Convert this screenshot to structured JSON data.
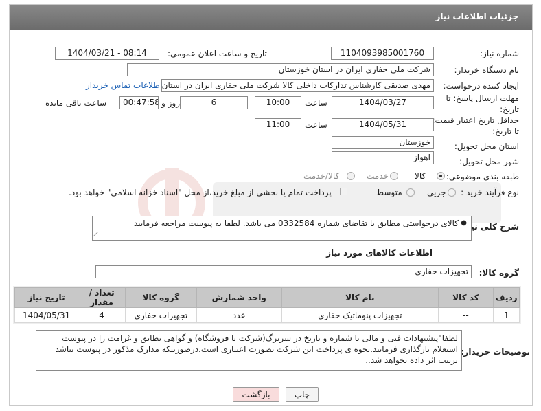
{
  "header": {
    "title": "جزئیات اطلاعات نیاز"
  },
  "need_number": {
    "label": "شماره نیاز:",
    "value": "1104093985001760"
  },
  "announce_datetime": {
    "label": "تاریخ و ساعت اعلان عمومی:",
    "value": "1404/03/21 - 08:14"
  },
  "buyer_org": {
    "label": "نام دستگاه خریدار:",
    "value": "شرکت ملی حفاری ایران در استان خوزستان"
  },
  "requester": {
    "label": "ایجاد کننده درخواست:",
    "value": "مهدی صدیقی کارشناس تدارکات داخلی کالا شرکت ملی حفاری ایران در استان",
    "contact_link": "اطلاعات تماس خریدار"
  },
  "reply_deadline": {
    "label_line1": "مهلت ارسال پاسخ: تا",
    "label_line2": "تاریخ:",
    "date": "1404/03/27",
    "time_label": "ساعت",
    "time": "10:00",
    "days": "6",
    "days_label": "روز و",
    "remaining": "00:47:58",
    "remaining_label": "ساعت باقی مانده"
  },
  "price_validity": {
    "label_line1": "حداقل تاریخ اعتبار قیمت:",
    "label_line2": "تا تاریخ:",
    "date": "1404/05/31",
    "time_label": "ساعت",
    "time": "11:00"
  },
  "delivery_province": {
    "label": "استان محل تحویل:",
    "value": "خوزستان"
  },
  "delivery_city": {
    "label": "شهر محل تحویل:",
    "value": "اهواز"
  },
  "category": {
    "label": "طبقه بندی موضوعی:",
    "options": [
      "کالا",
      "خدمت",
      "کالا/خدمت"
    ],
    "selected": "کالا"
  },
  "purchase_type": {
    "label": "نوع فرآیند خرید :",
    "options": [
      "جزیی",
      "متوسط"
    ],
    "payment_note": "پرداخت تمام یا بخشی از مبلغ خرید،از محل \"اسناد خزانه اسلامی\" خواهد بود."
  },
  "general_description": {
    "label": "شرح کلی نیاز:",
    "text": "کالای درخواستی مطابق با تقاضای شماره 0332584 می باشد. لطفا به پیوست مراجعه فرمایید"
  },
  "goods_section": {
    "title": "اطلاعات کالاهای مورد نیاز",
    "group_label": "گروه کالا:",
    "group_value": "تجهیزات حفاری"
  },
  "goods_table": {
    "headers": [
      "ردیف",
      "کد کالا",
      "نام کالا",
      "واحد شمارش",
      "گروه کالا",
      "تعداد / مقدار",
      "تاریخ نیاز"
    ],
    "rows": [
      [
        "1",
        "--",
        "تجهیزات پنوماتیک حفاری",
        "عدد",
        "تجهیزات حفاری",
        "4",
        "1404/05/31"
      ]
    ]
  },
  "buyer_notes": {
    "label": "توضیحات خریدار:",
    "text": "لطفا\"پیشنهادات فنی و مالی با شماره و تاریخ در سربرگ(شرکت یا فروشگاه) و گواهی تطابق و غرامت را در پیوست استعلام بارگذاری فرمایید.نحوه ی پرداخت این شرکت بصورت اعتباری است.درصورتیکه مدارک مذکور در پیوست نباشد ترتیب اثر داده نخواهد شد.."
  },
  "buttons": {
    "print": "چاپ",
    "back": "بازگشت"
  },
  "colors": {
    "header_bg": "#777777",
    "link": "#1a5fb4",
    "back_button_bg": "#f9dcdc",
    "table_header_bg": "#c8c8c8"
  }
}
